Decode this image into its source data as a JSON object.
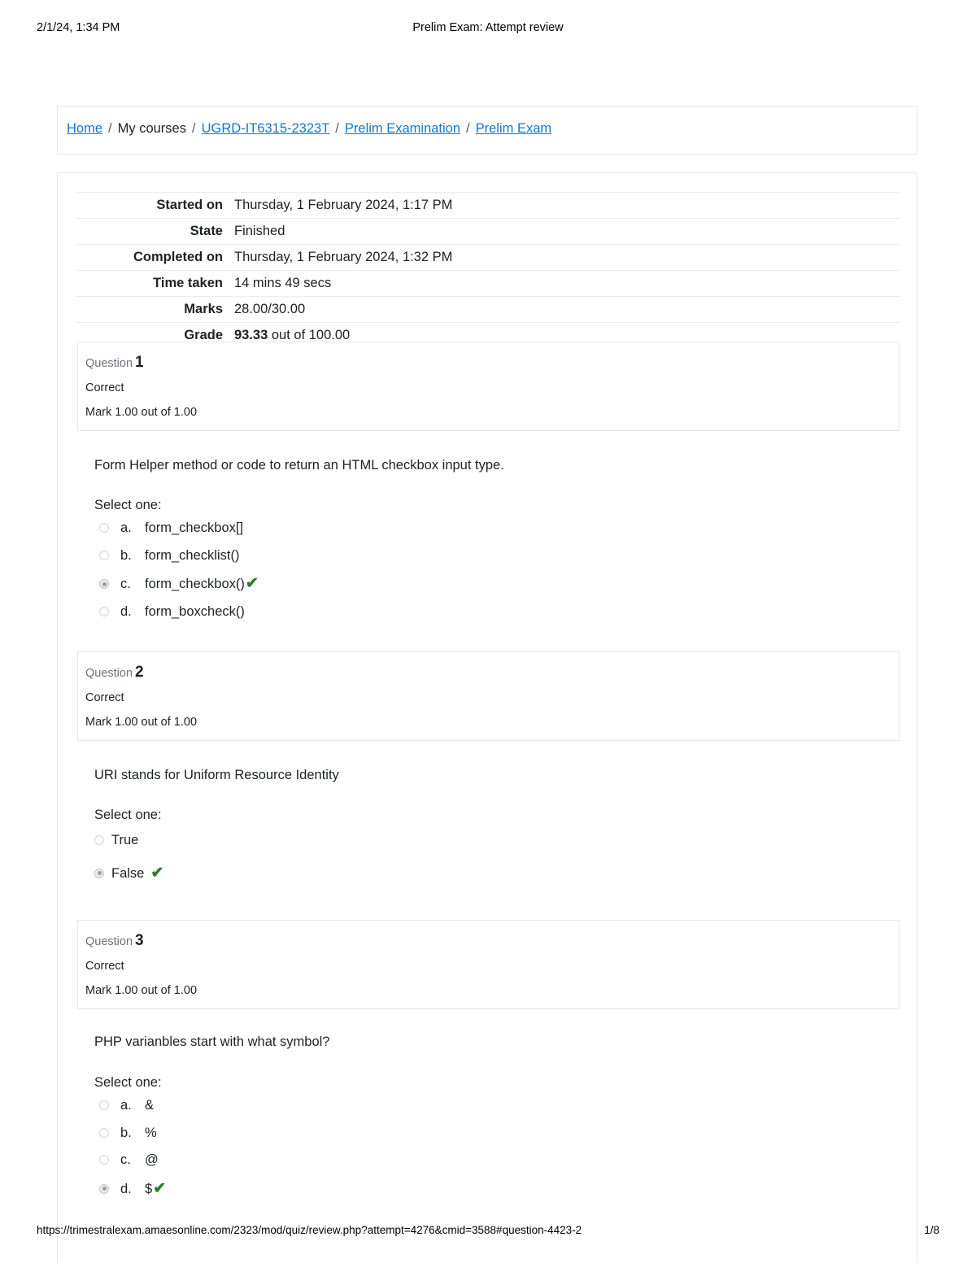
{
  "print_header": {
    "date": "2/1/24, 1:34 PM",
    "title": "Prelim Exam: Attempt review"
  },
  "breadcrumb": {
    "separator": "/",
    "items": [
      {
        "label": "Home",
        "link": true
      },
      {
        "label": "My courses",
        "link": false
      },
      {
        "label": "UGRD-IT6315-2323T",
        "link": true
      },
      {
        "label": "Prelim Examination",
        "link": true
      },
      {
        "label": "Prelim Exam",
        "link": true
      }
    ]
  },
  "summary": {
    "rows": [
      {
        "label": "Started on",
        "value": "Thursday, 1 February 2024, 1:17 PM"
      },
      {
        "label": "State",
        "value": "Finished"
      },
      {
        "label": "Completed on",
        "value": "Thursday, 1 February 2024, 1:32 PM"
      },
      {
        "label": "Time taken",
        "value": "14 mins 49 secs"
      },
      {
        "label": "Marks",
        "value": "28.00/30.00"
      }
    ],
    "grade": {
      "label": "Grade",
      "value_bold": "93.33",
      "value_rest": " out of 100.00"
    }
  },
  "questions": [
    {
      "number_label": "Question",
      "number": "1",
      "state": "Correct",
      "mark": "Mark 1.00 out of 1.00",
      "text": "Form Helper method or code to return an HTML checkbox input type.",
      "select_prompt": "Select one:",
      "style": "lettered",
      "options": [
        {
          "letter": "a.",
          "text": "form_checkbox[]",
          "selected": false,
          "correct_mark": false
        },
        {
          "letter": "b.",
          "text": "form_checklist()",
          "selected": false,
          "correct_mark": false
        },
        {
          "letter": "c.",
          "text": "form_checkbox()",
          "selected": true,
          "correct_mark": true
        },
        {
          "letter": "d.",
          "text": "form_boxcheck()",
          "selected": false,
          "correct_mark": false
        }
      ]
    },
    {
      "number_label": "Question",
      "number": "2",
      "state": "Correct",
      "mark": "Mark 1.00 out of 1.00",
      "text": "URI stands for Uniform Resource Identity",
      "select_prompt": "Select one:",
      "style": "plain",
      "options": [
        {
          "letter": "",
          "text": "True",
          "selected": false,
          "correct_mark": false
        },
        {
          "letter": "",
          "text": "False",
          "selected": true,
          "correct_mark": true
        }
      ]
    },
    {
      "number_label": "Question",
      "number": "3",
      "state": "Correct",
      "mark": "Mark 1.00 out of 1.00",
      "text": "PHP varianbles start with what symbol?",
      "select_prompt": "Select one:",
      "style": "lettered",
      "options": [
        {
          "letter": "a.",
          "text": "&",
          "selected": false,
          "correct_mark": false
        },
        {
          "letter": "b.",
          "text": "%",
          "selected": false,
          "correct_mark": false
        },
        {
          "letter": "c.",
          "text": "@",
          "selected": false,
          "correct_mark": false
        },
        {
          "letter": "d.",
          "text": "$",
          "selected": true,
          "correct_mark": true
        }
      ]
    }
  ],
  "icons": {
    "correct_check": "✔"
  },
  "print_footer": {
    "url": "https://trimestralexam.amaesonline.com/2323/mod/quiz/review.php?attempt=4276&cmid=3588#question-4423-2",
    "page": "1/8"
  },
  "colors": {
    "link": "#1177d1",
    "correct_green": "#2d7a2d",
    "border": "#e4e8ec",
    "text": "#1d2125"
  }
}
